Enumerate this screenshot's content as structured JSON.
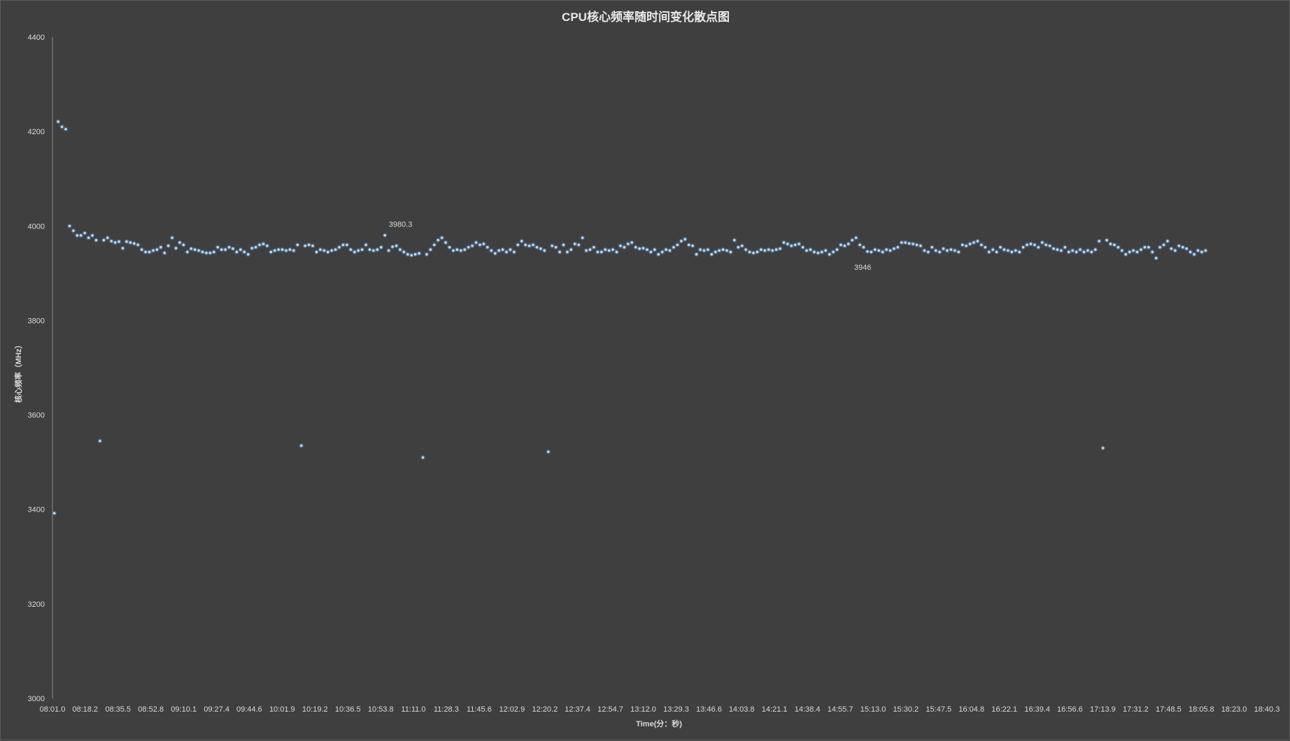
{
  "chart_data": {
    "type": "scatter",
    "title": "CPU核心频率随时间变化散点图",
    "xlabel": "Time(分：秒)",
    "ylabel": "核心频率（MHz）",
    "x_unit": "minutes:seconds (mm:ss.s)",
    "xlim": [
      "08:01.0",
      "18:40.3"
    ],
    "ylim": [
      3000,
      4400
    ],
    "x_ticks": [
      "08:01.0",
      "08:18.2",
      "08:35.5",
      "08:52.8",
      "09:10.1",
      "09:27.4",
      "09:44.6",
      "10:01.9",
      "10:19.2",
      "10:36.5",
      "10:53.8",
      "11:11.0",
      "11:28.3",
      "11:45.6",
      "12:02.9",
      "12:20.2",
      "12:37.4",
      "12:54.7",
      "13:12.0",
      "13:29.3",
      "13:46.6",
      "14:03.8",
      "14:21.1",
      "14:38.4",
      "14:55.7",
      "15:13.0",
      "15:30.2",
      "15:47.5",
      "16:04.8",
      "16:22.1",
      "16:39.4",
      "16:56.6",
      "17:13.9",
      "17:31.2",
      "17:48.5",
      "18:05.8",
      "18:23.0",
      "18:40.3"
    ],
    "y_ticks": [
      3000,
      3200,
      3400,
      3600,
      3800,
      4000,
      4200,
      4400
    ],
    "grid": false,
    "legend": "none",
    "marker_color": "#5b9bd5",
    "background_color": "#3f3f3f",
    "series": [
      {
        "x_start": "08:02.0",
        "x_step_seconds": 2,
        "values": [
          3392,
          4221,
          4210,
          4205,
          4000,
          3990,
          3980,
          3980,
          3985,
          3975,
          3980,
          3970,
          3545,
          3970,
          3975,
          3968,
          3965,
          3967,
          3953,
          3967,
          3965,
          3963,
          3960,
          3950,
          3945,
          3945,
          3948,
          3950,
          3955,
          3943,
          3958,
          3975,
          3953,
          3965,
          3960,
          3945,
          3952,
          3950,
          3948,
          3945,
          3943,
          3943,
          3945,
          3955,
          3950,
          3950,
          3955,
          3952,
          3945,
          3950,
          3945,
          3940,
          3953,
          3955,
          3960,
          3962,
          3958,
          3945,
          3948,
          3950,
          3950,
          3948,
          3950,
          3948,
          3960,
          3535,
          3958,
          3960,
          3958,
          3945,
          3950,
          3948,
          3945,
          3948,
          3950,
          3955,
          3960,
          3960,
          3950,
          3945,
          3948,
          3950,
          3960,
          3950,
          3948,
          3950,
          3955,
          3980.3,
          3948,
          3956,
          3958,
          3950,
          3945,
          3940,
          3938,
          3940,
          3942,
          3510,
          3940,
          3950,
          3960,
          3970,
          3975,
          3965,
          3955,
          3948,
          3950,
          3948,
          3950,
          3955,
          3958,
          3965,
          3960,
          3962,
          3955,
          3948,
          3942,
          3948,
          3950,
          3945,
          3950,
          3945,
          3960,
          3968,
          3960,
          3958,
          3960,
          3955,
          3952,
          3948,
          3522,
          3958,
          3955,
          3945,
          3960,
          3945,
          3950,
          3962,
          3960,
          3975,
          3948,
          3950,
          3955,
          3945,
          3945,
          3950,
          3948,
          3950,
          3945,
          3958,
          3955,
          3962,
          3965,
          3955,
          3952,
          3953,
          3950,
          3945,
          3950,
          3940,
          3945,
          3950,
          3948,
          3955,
          3960,
          3968,
          3972,
          3960,
          3958,
          3940,
          3950,
          3948,
          3950,
          3940,
          3945,
          3948,
          3950,
          3948,
          3945,
          3970,
          3955,
          3958,
          3950,
          3945,
          3943,
          3945,
          3950,
          3948,
          3950,
          3948,
          3950,
          3952,
          3965,
          3962,
          3958,
          3960,
          3962,
          3955,
          3948,
          3950,
          3945,
          3943,
          3945,
          3948,
          3940,
          3945,
          3950,
          3960,
          3958,
          3962,
          3970,
          3975,
          3960,
          3955,
          3946,
          3945,
          3950,
          3948,
          3945,
          3950,
          3948,
          3952,
          3955,
          3965,
          3965,
          3963,
          3962,
          3960,
          3958,
          3948,
          3945,
          3955,
          3948,
          3945,
          3952,
          3948,
          3950,
          3948,
          3945,
          3960,
          3958,
          3962,
          3965,
          3968,
          3960,
          3955,
          3945,
          3950,
          3945,
          3955,
          3950,
          3948,
          3945,
          3948,
          3945,
          3955,
          3960,
          3962,
          3960,
          3955,
          3965,
          3960,
          3958,
          3952,
          3950,
          3948,
          3955,
          3945,
          3948,
          3945,
          3950,
          3945,
          3948,
          3945,
          3950,
          3968,
          3530,
          3970,
          3962,
          3960,
          3955,
          3948,
          3940,
          3945,
          3948,
          3945,
          3950,
          3955,
          3955,
          3945,
          3932,
          3955,
          3960,
          3968,
          3952,
          3948,
          3958,
          3955,
          3952,
          3945,
          3940,
          3948,
          3945,
          3948
        ]
      }
    ],
    "annotations": [
      {
        "label": "3980.3",
        "x": "10:54.0",
        "y": 3980.3
      },
      {
        "label": "3946",
        "x": "15:03.0",
        "y": 3946
      }
    ]
  }
}
